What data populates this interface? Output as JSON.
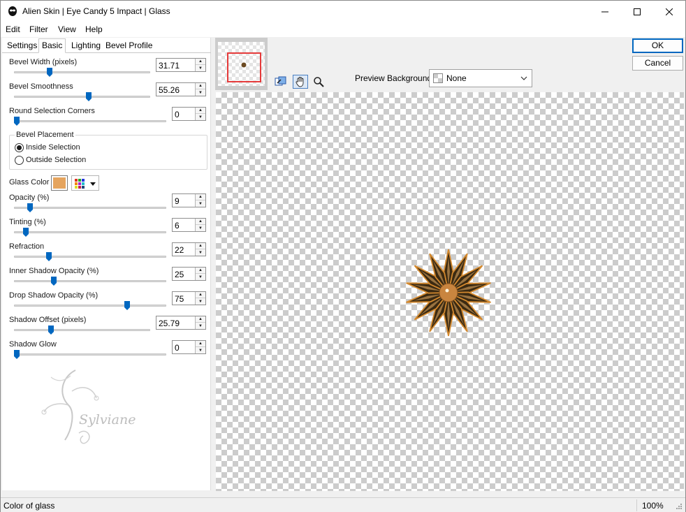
{
  "window": {
    "title": "Alien Skin | Eye Candy 5 Impact | Glass"
  },
  "menu": [
    "Edit",
    "Filter",
    "View",
    "Help"
  ],
  "tabs": [
    "Settings",
    "Basic",
    "Lighting",
    "Bevel Profile"
  ],
  "active_tab": "Basic",
  "controls": {
    "bevel_width": {
      "label": "Bevel Width (pixels)",
      "value": "31.71",
      "fraction": 0.25
    },
    "bevel_smoothness": {
      "label": "Bevel Smoothness",
      "value": "55.26",
      "fraction": 0.55
    },
    "round_corners": {
      "label": "Round Selection Corners",
      "value": "0",
      "fraction": 0.0
    },
    "opacity": {
      "label": "Opacity (%)",
      "value": "9",
      "fraction": 0.09
    },
    "tinting": {
      "label": "Tinting (%)",
      "value": "6",
      "fraction": 0.06
    },
    "refraction": {
      "label": "Refraction",
      "value": "22",
      "fraction": 0.22
    },
    "inner_shadow": {
      "label": "Inner Shadow Opacity (%)",
      "value": "25",
      "fraction": 0.25
    },
    "drop_shadow": {
      "label": "Drop Shadow Opacity (%)",
      "value": "75",
      "fraction": 0.75
    },
    "shadow_offset": {
      "label": "Shadow Offset (pixels)",
      "value": "25.79",
      "fraction": 0.26
    },
    "shadow_glow": {
      "label": "Shadow Glow",
      "value": "0",
      "fraction": 0.0
    }
  },
  "bevel_placement": {
    "legend": "Bevel Placement",
    "options": [
      "Inside Selection",
      "Outside Selection"
    ],
    "selected": "Inside Selection"
  },
  "glass_color": {
    "label": "Glass Color",
    "color": "#e5a45e"
  },
  "preview_background": {
    "label": "Preview Background:",
    "value": "None"
  },
  "buttons": {
    "ok": "OK",
    "cancel": "Cancel"
  },
  "status": {
    "text": "Color of glass",
    "zoom": "100%"
  },
  "watermark": {
    "signature": "Sylviane"
  },
  "colors": {
    "accent": "#0067c0",
    "thumb_frame": "#e53a3a",
    "flower_dark": "#3b2a12",
    "flower_edge": "#d4892e",
    "flower_center": "#c9853f"
  }
}
